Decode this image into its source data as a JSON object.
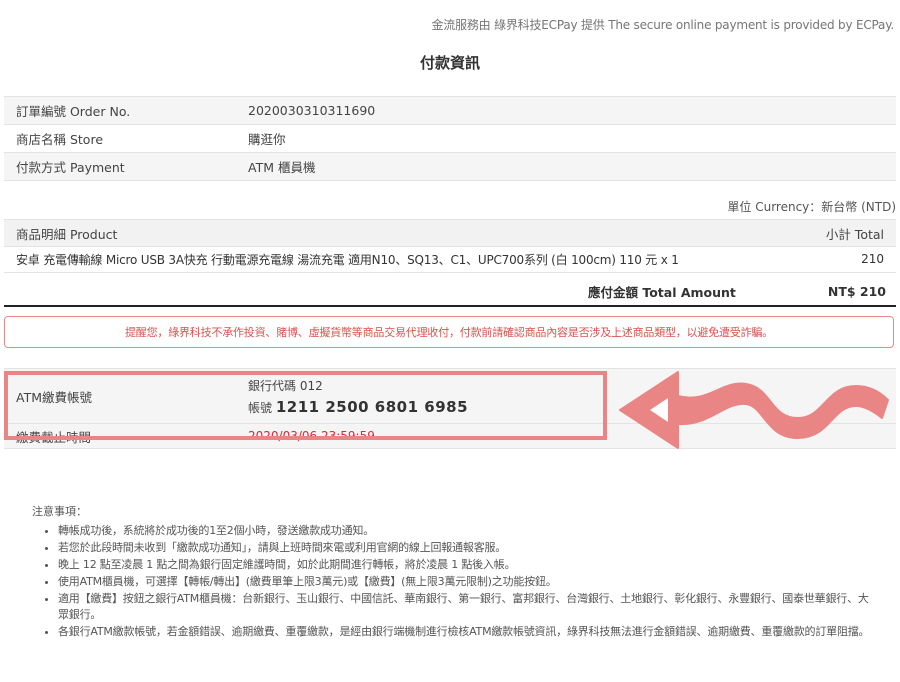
{
  "provider_note": "金流服務由 綠界科技ECPay 提供 The secure online payment is provided by ECPay.",
  "page_title": "付款資訊",
  "order_info": [
    {
      "label": "訂單編號 Order No.",
      "value": "2020030310311690"
    },
    {
      "label": "商店名稱 Store",
      "value": "購逛你"
    },
    {
      "label": "付款方式 Payment",
      "value": "ATM 櫃員機"
    }
  ],
  "currency_note": "單位 Currency：新台幣 (NTD)",
  "product_table": {
    "header_product": "商品明細 Product",
    "header_subtotal": "小計 Total",
    "items": [
      {
        "name": "安卓 充電傳輸線 Micro USB 3A快充 行動電源充電線 湯流充電 適用N10、SQ13、C1、UPC700系列 (白 100cm) 110 元 x 1",
        "subtotal": "210"
      }
    ],
    "total_label": "應付金額 Total Amount",
    "total_value": "NT$ 210"
  },
  "warning": "提醒您，綠界科技不承作投資、賭博、虛擬貨幣等商品交易代理收付，付款前請確認商品內容是否涉及上述商品類型，以避免遭受詐騙。",
  "atm": {
    "account_label": "ATM繳費帳號",
    "bank_code": "銀行代碼 012",
    "account_prefix": "帳號",
    "account_number": "1211 2500 6801 6985",
    "deadline_label": "繳費截止時間",
    "deadline_value": "2020/03/06 23:59:59"
  },
  "highlight_color": "#ea8585",
  "notes": {
    "title": "注意事項：",
    "items": [
      "轉帳成功後，系統將於成功後的1至2個小時，發送繳款成功通知。",
      "若您於此段時間未收到「繳款成功通知」，請與上班時間來電或利用官網的線上回報通報客服。",
      "晚上 12 點至凌晨 1 點之間為銀行固定維護時間，如於此期間進行轉帳，將於凌晨 1 點後入帳。",
      "使用ATM櫃員機，可選擇【轉帳/轉出】(繳費單筆上限3萬元)或【繳費】(無上限3萬元限制)之功能按鈕。",
      "適用【繳費】按鈕之銀行ATM櫃員機：台新銀行、玉山銀行、中國信託、華南銀行、第一銀行、富邦銀行、台灣銀行、土地銀行、彰化銀行、永豐銀行、國泰世華銀行、大眾銀行。",
      "各銀行ATM繳款帳號，若金額錯誤、逾期繳費、重覆繳款，是經由銀行端機制進行檢核ATM繳款帳號資訊，綠界科技無法進行金額錯誤、逾期繳費、重覆繳款的訂單阻擋。"
    ]
  }
}
